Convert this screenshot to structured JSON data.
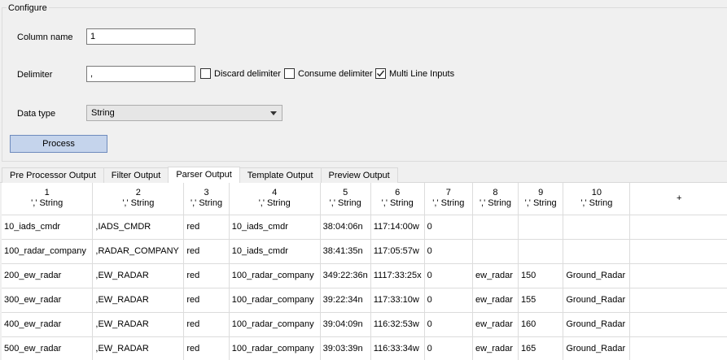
{
  "configure": {
    "title": "Configure",
    "column_name_label": "Column name",
    "column_name_value": "1",
    "delimiter_label": "Delimiter",
    "delimiter_value": ",",
    "discard_delimiter": {
      "label": "Discard delimiter",
      "checked": false
    },
    "consume_delimiter": {
      "label": "Consume delimiter",
      "checked": false
    },
    "multi_line_inputs": {
      "label": "Multi Line Inputs",
      "checked": true
    },
    "data_type_label": "Data type",
    "data_type_value": "String",
    "process_label": "Process"
  },
  "tabs": [
    {
      "label": "Pre Processor Output",
      "active": false
    },
    {
      "label": "Filter Output",
      "active": false
    },
    {
      "label": "Parser Output",
      "active": true
    },
    {
      "label": "Template Output",
      "active": false
    },
    {
      "label": "Preview Output",
      "active": false
    }
  ],
  "grid": {
    "columns": [
      {
        "num": "1",
        "type": "',' String"
      },
      {
        "num": "2",
        "type": "',' String"
      },
      {
        "num": "3",
        "type": "',' String"
      },
      {
        "num": "4",
        "type": "',' String"
      },
      {
        "num": "5",
        "type": "',' String"
      },
      {
        "num": "6",
        "type": "',' String"
      },
      {
        "num": "7",
        "type": "',' String"
      },
      {
        "num": "8",
        "type": "',' String"
      },
      {
        "num": "9",
        "type": "',' String"
      },
      {
        "num": "10",
        "type": "',' String"
      }
    ],
    "add_column_label": "+",
    "rows": [
      [
        "10_iads_cmdr",
        ",IADS_CMDR",
        "red",
        "10_iads_cmdr",
        "38:04:06n",
        "117:14:00w",
        "0",
        "",
        "",
        ""
      ],
      [
        "100_radar_company",
        ",RADAR_COMPANY",
        "red",
        "10_iads_cmdr",
        "38:41:35n",
        "117:05:57w",
        "0",
        "",
        "",
        ""
      ],
      [
        "200_ew_radar",
        ",EW_RADAR",
        "red",
        "100_radar_company",
        "349:22:36n",
        "1117:33:25x",
        "0",
        "ew_radar",
        "150",
        "Ground_Radar"
      ],
      [
        "300_ew_radar",
        ",EW_RADAR",
        "red",
        "100_radar_company",
        "39:22:34n",
        "117:33:10w",
        "0",
        "ew_radar",
        "155",
        "Ground_Radar"
      ],
      [
        "400_ew_radar",
        ",EW_RADAR",
        "red",
        "100_radar_company",
        "39:04:09n",
        "116:32:53w",
        "0",
        "ew_radar",
        "160",
        "Ground_Radar"
      ],
      [
        "500_ew_radar",
        ",EW_RADAR",
        "red",
        "100_radar_company",
        "39:03:39n",
        "116:33:34w",
        "0",
        "ew_radar",
        "165",
        "Ground_Radar"
      ]
    ]
  }
}
